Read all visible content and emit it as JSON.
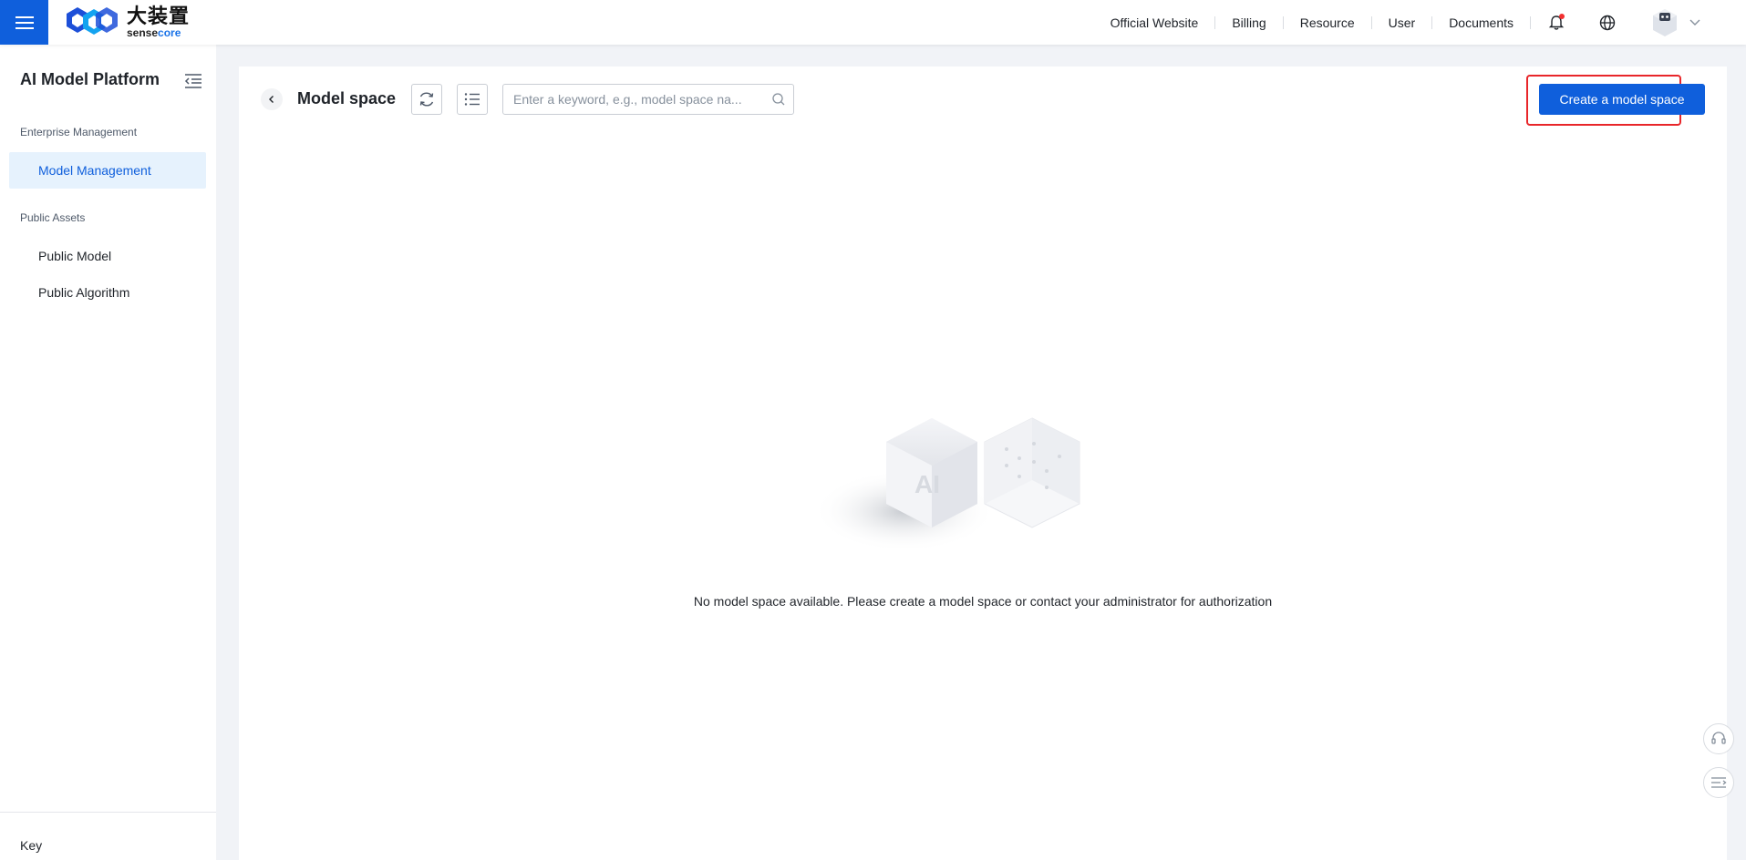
{
  "topbar": {
    "logo_cn": "大装置",
    "logo_en_prefix": "sense",
    "logo_en_suffix": "core",
    "nav": [
      "Official Website",
      "Billing",
      "Resource",
      "User",
      "Documents"
    ]
  },
  "sidebar": {
    "title": "AI Model Platform",
    "groups": [
      {
        "label": "Enterprise Management",
        "items": [
          "Model Management"
        ]
      },
      {
        "label": "Public Assets",
        "items": [
          "Public Model",
          "Public Algorithm"
        ]
      }
    ],
    "active_item": "Model Management",
    "footer": "Key"
  },
  "main": {
    "title": "Model space",
    "search_placeholder": "Enter a keyword, e.g., model space na...",
    "search_value": "",
    "create_button": "Create a model space",
    "empty_message": "No model space available. Please create a model space or contact your administrator for authorization",
    "illustration_text": "AI"
  },
  "colors": {
    "primary": "#0f5fdc",
    "highlight": "#e8262a",
    "active_bg": "#e6f2fd"
  }
}
